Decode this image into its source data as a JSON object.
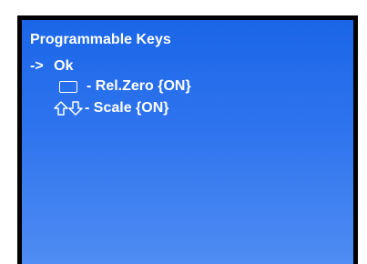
{
  "menu": {
    "title": "Programmable Keys",
    "selected_marker": "->",
    "selected_item": "Ok",
    "items": [
      {
        "icon": "rectangle-key-icon",
        "label": "- Rel.Zero {ON}"
      },
      {
        "icon": "up-down-arrows-icon",
        "label": "- Scale {ON}"
      }
    ]
  },
  "colors": {
    "frame": "#000000",
    "screen_top": "#1a66e8",
    "screen_bottom": "#4f8cf3",
    "text": "#ffffff"
  }
}
